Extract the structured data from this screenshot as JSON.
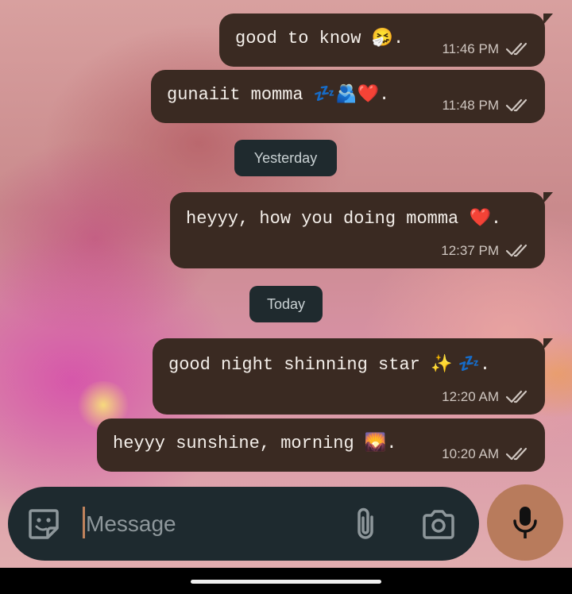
{
  "messages": [
    {
      "text": "good to know",
      "emoji": "🤧",
      "suffix": ".",
      "time": "11:46 PM",
      "status_icon": "double-check-icon"
    },
    {
      "text": "gunaiit momma",
      "emoji": "💤🫂❤️",
      "suffix": ".",
      "time": "11:48 PM",
      "status_icon": "double-check-icon"
    },
    {
      "text": "heyyy, how you doing momma",
      "emoji": "❤️",
      "suffix": ".",
      "time": "12:37 PM",
      "status_icon": "double-check-icon"
    },
    {
      "text": "good night shinning star",
      "emoji": "✨ 💤",
      "suffix": ".",
      "time": "12:20 AM",
      "status_icon": "double-check-icon"
    },
    {
      "text": "heyyy sunshine, morning",
      "emoji": "🌄",
      "suffix": ".",
      "time": "10:20 AM",
      "status_icon": "double-check-icon"
    }
  ],
  "date_separators": [
    "Yesterday",
    "Today"
  ],
  "composer": {
    "placeholder": "Message",
    "icons": [
      "sticker-icon",
      "attach-icon",
      "camera-icon"
    ]
  },
  "mic_button": {
    "icon": "microphone-icon"
  },
  "colors": {
    "bubble": "#3a2a22",
    "date_pill": "#1f2a2e",
    "composer": "#1e2a2f",
    "mic_button": "#b87b5c",
    "caret": "#c0835c"
  }
}
